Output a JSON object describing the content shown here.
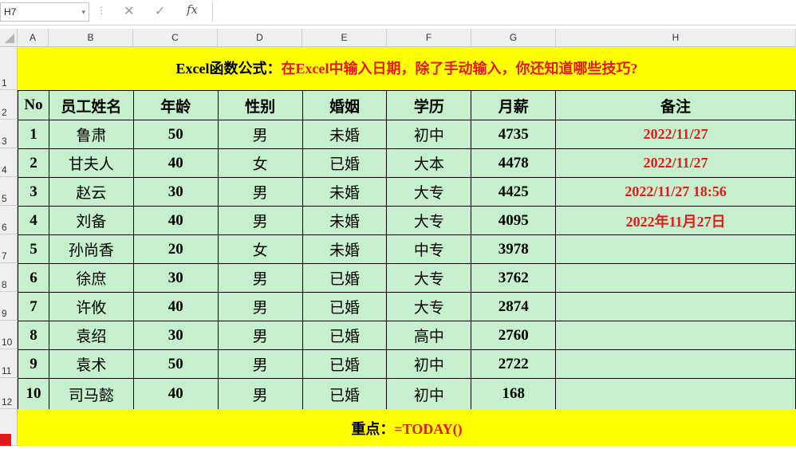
{
  "formula_bar": {
    "name_box": "H7",
    "fx_label": "fx",
    "formula": ""
  },
  "column_headers": [
    "A",
    "B",
    "C",
    "D",
    "E",
    "F",
    "G",
    "H"
  ],
  "row_headers": [
    "1",
    "2",
    "3",
    "4",
    "5",
    "6",
    "7",
    "8",
    "9",
    "10",
    "11",
    "12"
  ],
  "title": {
    "part1": "Excel函数公式：",
    "part2": "在Excel中输入日期，除了手动输入，你还知道哪些技巧?"
  },
  "table": {
    "headers": [
      "No",
      "员工姓名",
      "年龄",
      "性别",
      "婚姻",
      "学历",
      "月薪",
      "备注"
    ],
    "rows": [
      [
        "1",
        "鲁肃",
        "50",
        "男",
        "未婚",
        "初中",
        "4735",
        "2022/11/27"
      ],
      [
        "2",
        "甘夫人",
        "40",
        "女",
        "已婚",
        "大本",
        "4478",
        "2022/11/27"
      ],
      [
        "3",
        "赵云",
        "30",
        "男",
        "未婚",
        "大专",
        "4425",
        "2022/11/27 18:56"
      ],
      [
        "4",
        "刘备",
        "40",
        "男",
        "未婚",
        "大专",
        "4095",
        "2022年11月27日"
      ],
      [
        "5",
        "孙尚香",
        "20",
        "女",
        "未婚",
        "中专",
        "3978",
        ""
      ],
      [
        "6",
        "徐庶",
        "30",
        "男",
        "已婚",
        "大专",
        "3762",
        ""
      ],
      [
        "7",
        "许攸",
        "40",
        "男",
        "已婚",
        "大专",
        "2874",
        ""
      ],
      [
        "8",
        "袁绍",
        "30",
        "男",
        "已婚",
        "高中",
        "2760",
        ""
      ],
      [
        "9",
        "袁术",
        "50",
        "男",
        "已婚",
        "初中",
        "2722",
        ""
      ],
      [
        "10",
        "司马懿",
        "40",
        "男",
        "已婚",
        "初中",
        "168",
        ""
      ]
    ]
  },
  "footer": {
    "part1": "重点：",
    "part2": "=TODAY()"
  },
  "colors": {
    "band_yellow": "#ffff00",
    "cell_green": "#c6efce",
    "accent_red": "#e41a1a"
  }
}
